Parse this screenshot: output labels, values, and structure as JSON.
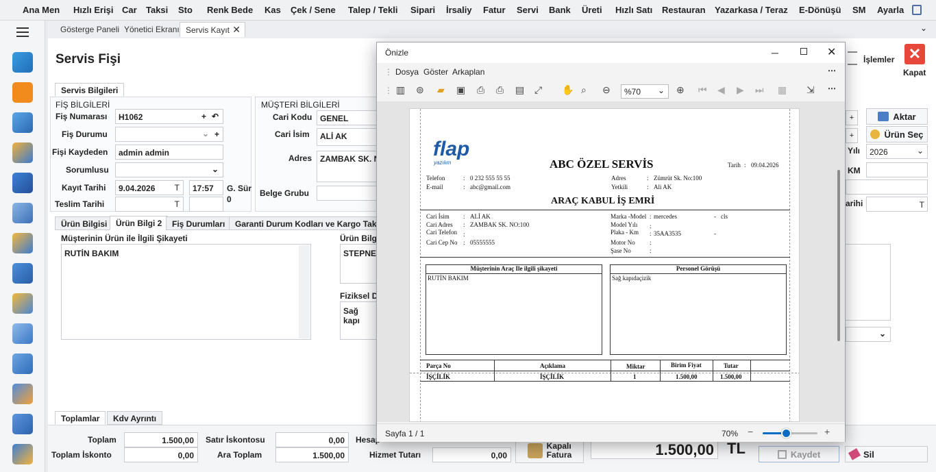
{
  "menu": [
    "Ana Men",
    "Hızlı Erişi",
    "Car",
    "Taksi",
    "Sto",
    "Renk Bede",
    "Kas",
    "Çek / Sene",
    "Talep / Tekli",
    "Sipari",
    "İrsaliy",
    "Fatur",
    "Servi",
    "Bank",
    "Üreti",
    "Hızlı Satı",
    "Restauran",
    "Yazarkasa / Teraz",
    "E-Dönüşü",
    "SM",
    "Ayarla"
  ],
  "tabs": [
    "Gösterge Paneli",
    "Yönetici Ekranı",
    "Servis Kayıt"
  ],
  "page_title": "Servis Fişi",
  "header_right": {
    "islemler": "İşlemler",
    "kapat": "Kapat"
  },
  "section_tab": "Servis Bilgileri",
  "fis": {
    "group_title": "FİŞ BİLGİLERİ",
    "numara_label": "Fiş Numarası",
    "numara": "H1062",
    "durum_label": "Fiş Durumu",
    "durum": "",
    "kaydeden_label": "Fişi Kaydeden",
    "kaydeden": "admin admin",
    "sorumlu_label": "Sorumlusu",
    "sorumlu": "",
    "kayit_label": "Kayıt Tarihi",
    "kayit_tarih": "9.04.2026",
    "kayit_saat": "17:57",
    "gsur_label": "G. Sür",
    "gsur_value": "0",
    "teslim_label": "Teslim Tarihi",
    "teslim": ""
  },
  "musteri": {
    "group_title": "MÜŞTERİ BİLGİLERİ",
    "kod_label": "Cari Kodu",
    "kod": "GENEL",
    "isim_label": "Cari İsim",
    "isim": "ALİ AK",
    "adres_label": "Adres",
    "adres": "ZAMBAK SK. NO",
    "belge_label": "Belge Grubu"
  },
  "right_panel": {
    "aktar": "Aktar",
    "urun_sec": "Ürün Seç",
    "yil_label": "Yılı",
    "yil": "2026",
    "km_label": "KM",
    "tarih_label": "arihi",
    "t": "T"
  },
  "subtabs": [
    "Ürün Bilgisi",
    "Ürün Bilgi 2",
    "Fiş Durumları",
    "Garanti Durum Kodları ve Kargo Takip"
  ],
  "sikayet_label": "Müşterinin Ürün ile İlgili Şikayeti",
  "sikayet": "RUTİN BAKIM",
  "urun_bilgi_label": "Ürün Bilgi",
  "urun_bilgi": "STEPNE",
  "fiziksel_label": "Fiziksel D",
  "fiziksel": "Sağ kapı",
  "bottom_tabs": [
    "Toplamlar",
    "Kdv Ayrıntı"
  ],
  "totals": {
    "toplam_label": "Toplam",
    "toplam": "1.500,00",
    "iskonto_label": "Toplam İskonto",
    "iskonto": "0,00",
    "satir_label": "Satır İskontosu",
    "satir": "0,00",
    "ara_label": "Ara Toplam",
    "ara": "1.500,00",
    "hesap_label": "Hesap",
    "hizmet_label": "Hizmet Tutarı",
    "hizmet": "0,00",
    "fatura_top": "Kapalı",
    "fatura": "Fatura",
    "grand": "1.500,00",
    "currency": "TL",
    "kaydet": "Kaydet",
    "sil": "Sil"
  },
  "dialog": {
    "title": "Önizle",
    "menu": [
      "Dosya",
      "Göster",
      "Arkaplan"
    ],
    "zoom_select": "%70",
    "status_page": "Sayfa 1 / 1",
    "status_zoom": "70%",
    "zoom_level": 0.42
  },
  "report": {
    "logo": "flap",
    "logo_sub": "yazılım",
    "company": "ABC ÖZEL SERVİS",
    "tarih_label": "Tarih",
    "tarih": "09.04.2026",
    "telefon_label": "Telefon",
    "telefon": "0 232 555 55 55",
    "email_label": "E-mail",
    "email": "abc@gmail.com",
    "adres_label": "Adres",
    "adres": "Zümrüt Sk. No:100",
    "yetkili_label": "Yetkili",
    "yetkili": "Ali AK",
    "doc_title": "ARAÇ KABUL İŞ EMRİ",
    "cari_isim_label": "Cari İsim",
    "cari_isim": "ALİ AK",
    "cari_adres_label": "Cari Adres",
    "cari_adres": "ZAMBAK SK. NO:100",
    "cari_tel_label": "Cari Telefon",
    "cari_cep_label": "Cari Cep No",
    "cari_cep": "05555555",
    "marka_label": "Marka -Model",
    "marka": "mercedes",
    "model_sep": "-",
    "model": "cls",
    "model_yili_label": "Model Yılı",
    "plaka_label": "Plaka - Km",
    "plaka": "35AA3535",
    "km_sep": "-",
    "motor_label": "Motor No",
    "sase_label": "Şase No",
    "box1_title": "Müşterinin Araç Ile ilgili şikayeti",
    "box1_text": "RUTİN BAKIM",
    "box2_title": "Personel Görüşü",
    "box2_text": "Sağ kapıdaçizik",
    "th": [
      "Parça No",
      "Açıklama",
      "Miktar",
      "Birim Fiyat",
      "Tutar"
    ],
    "row": [
      "İŞÇİLİK",
      "İŞÇİLİK",
      "1",
      "1.500,00",
      "1.500,00"
    ]
  }
}
